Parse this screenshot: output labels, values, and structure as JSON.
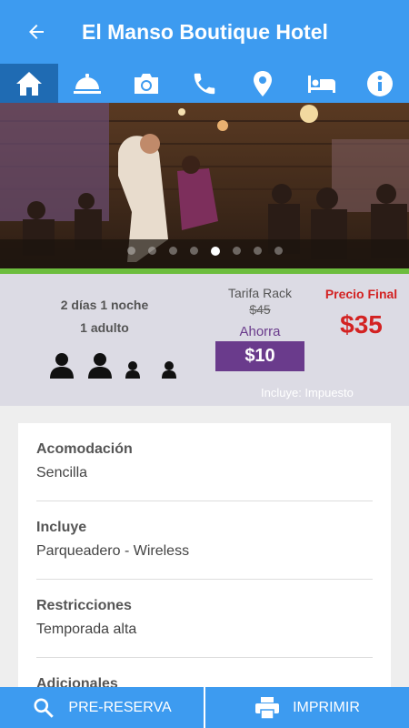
{
  "header": {
    "title": "El Manso Boutique Hotel",
    "back_icon": "arrow-left-icon"
  },
  "tabs": [
    {
      "icon": "home-icon",
      "active": true
    },
    {
      "icon": "room-service-icon",
      "active": false
    },
    {
      "icon": "camera-icon",
      "active": false
    },
    {
      "icon": "phone-icon",
      "active": false
    },
    {
      "icon": "map-pin-icon",
      "active": false
    },
    {
      "icon": "bed-icon",
      "active": false
    },
    {
      "icon": "info-icon",
      "active": false
    }
  ],
  "gallery": {
    "slide_count": 8,
    "current_slide": 5
  },
  "booking": {
    "nights": "2 días 1 noche",
    "guests": "1 adulto",
    "rack_label": "Tarifa Rack",
    "rack_price": "$45",
    "savings_label": "Ahorra",
    "savings_amount": "$10",
    "final_label": "Precio Final",
    "final_price": "$35",
    "tax_note": "Incluye: Impuesto"
  },
  "details": [
    {
      "label": "Acomodación",
      "value": "Sencilla"
    },
    {
      "label": "Incluye",
      "value": "Parqueadero - Wireless"
    },
    {
      "label": "Restricciones",
      "value": "Temporada alta"
    },
    {
      "label": "Adicionales",
      "value": ""
    }
  ],
  "actions": {
    "prereserve": "PRE-RESERVA",
    "print": "IMPRIMIR"
  },
  "colors": {
    "primary": "#3d9bf0",
    "active_tab": "#1f6bb3",
    "accent_purple": "#6a3b8c",
    "price_red": "#d32222",
    "divider_green": "#6cbd3e"
  }
}
